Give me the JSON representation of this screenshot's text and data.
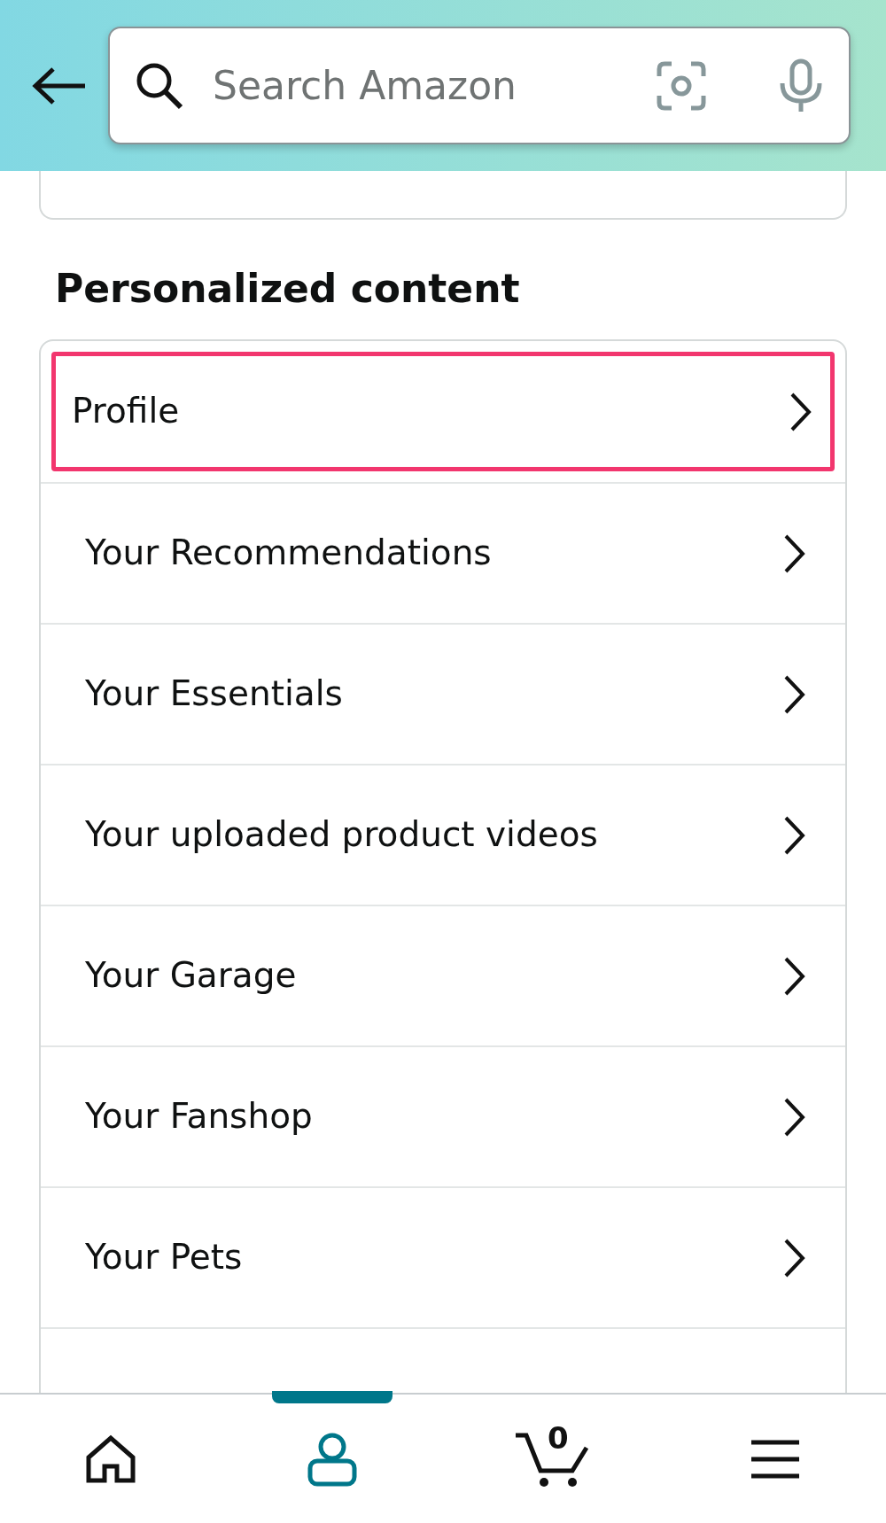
{
  "search": {
    "placeholder": "Search Amazon"
  },
  "section": {
    "title": "Personalized content",
    "items": [
      {
        "label": "Profile",
        "highlighted": true
      },
      {
        "label": "Your Recommendations",
        "highlighted": false
      },
      {
        "label": "Your Essentials",
        "highlighted": false
      },
      {
        "label": "Your uploaded product videos",
        "highlighted": false
      },
      {
        "label": "Your Garage",
        "highlighted": false
      },
      {
        "label": "Your Fanshop",
        "highlighted": false
      },
      {
        "label": "Your Pets",
        "highlighted": false
      }
    ]
  },
  "bottom_nav": [
    {
      "kind": "home",
      "selected": false
    },
    {
      "kind": "account",
      "selected": true
    },
    {
      "kind": "cart",
      "selected": false,
      "count": "0"
    },
    {
      "kind": "menu",
      "selected": false
    }
  ]
}
